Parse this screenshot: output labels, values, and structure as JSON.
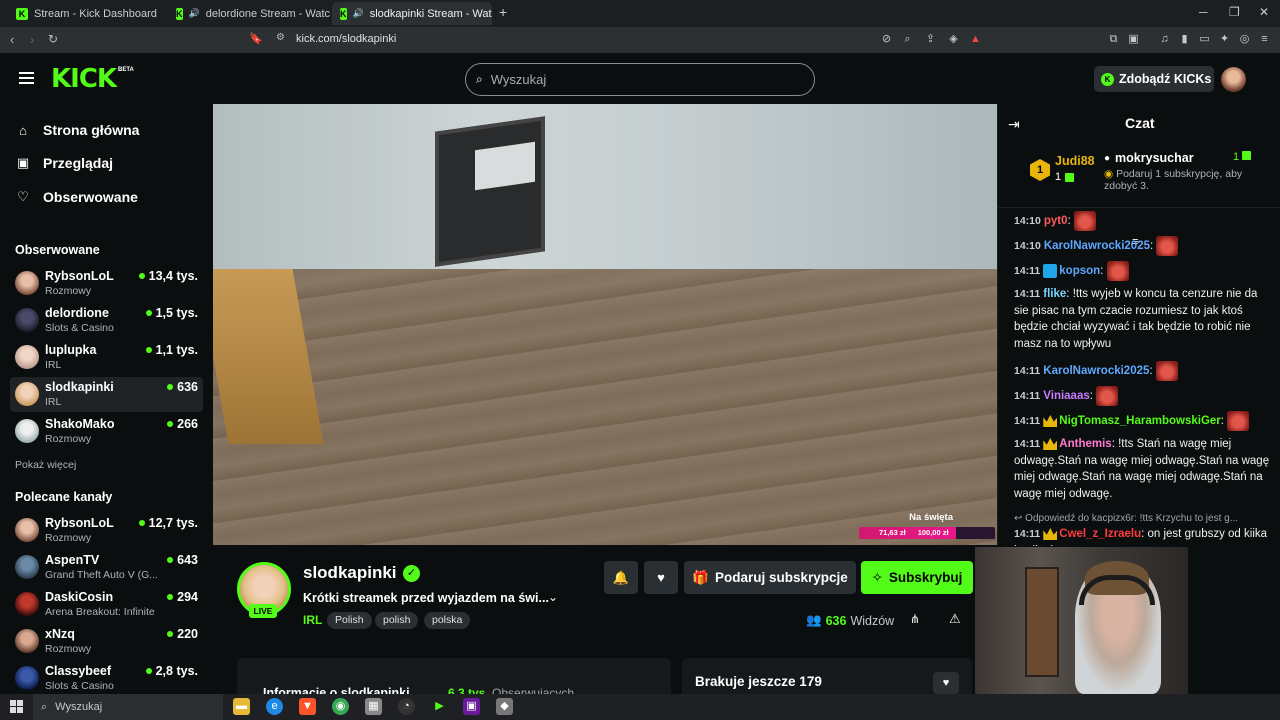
{
  "browser": {
    "tabs": [
      {
        "title": "Stream - Kick Dashboard"
      },
      {
        "title": "delordione Stream - Watch Live o"
      },
      {
        "title": "slodkapinki Stream - Watch Li"
      }
    ],
    "url": "kick.com/slodkapinki"
  },
  "header": {
    "logo": "KICK",
    "logo_tag": "BETA",
    "search_placeholder": "Wyszukaj",
    "get_kicks": "Zdobądź KICKs"
  },
  "sidebar": {
    "nav": [
      {
        "label": "Strona główna",
        "icon": "home-icon"
      },
      {
        "label": "Przeglądaj",
        "icon": "browse-icon"
      },
      {
        "label": "Obserwowane",
        "icon": "heart-icon"
      }
    ],
    "following_title": "Obserwowane",
    "following": [
      {
        "name": "RybsonLoL",
        "category": "Rozmowy",
        "viewers": "13,4 tys."
      },
      {
        "name": "delordione",
        "category": "Slots & Casino",
        "viewers": "1,5 tys."
      },
      {
        "name": "luplupka",
        "category": "IRL",
        "viewers": "1,1 tys."
      },
      {
        "name": "slodkapinki",
        "category": "IRL",
        "viewers": "636"
      },
      {
        "name": "ShakoMako",
        "category": "Rozmowy",
        "viewers": "266"
      }
    ],
    "show_more": "Pokaż więcej",
    "recommended_title": "Polecane kanały",
    "recommended": [
      {
        "name": "RybsonLoL",
        "category": "Rozmowy",
        "viewers": "12,7 tys."
      },
      {
        "name": "AspenTV",
        "category": "Grand Theft Auto V (G...",
        "viewers": "643"
      },
      {
        "name": "DaskiCosin",
        "category": "Arena Breakout: Infinite",
        "viewers": "294"
      },
      {
        "name": "xNzq",
        "category": "Rozmowy",
        "viewers": "220"
      },
      {
        "name": "Classybeef",
        "category": "Slots & Casino",
        "viewers": "2,8 tys."
      }
    ]
  },
  "video": {
    "goal_title": "Na święta",
    "goal_current": "71,63 zł",
    "goal_target": "100,00 zł",
    "goal_progress": 0.7163
  },
  "channel": {
    "name": "slodkapinki",
    "live": "LIVE",
    "title": "Krótki streamek przed wyjazdem na świ...",
    "category": "IRL",
    "tags": [
      "Polish",
      "polish",
      "polska"
    ],
    "gift_sub": "Podaruj subskrypcje",
    "subscribe": "Subskrybuj",
    "viewers": "636",
    "viewers_label": "Widzów",
    "about_title": "Informacje o slodkapinki",
    "followers": "6,3 tys.",
    "followers_label": "Obserwujących",
    "goal_card_title": "Brakuje jeszcze 179"
  },
  "chat": {
    "title": "Czat",
    "top_gifter": {
      "rank": "1",
      "name": "Judi88",
      "count": "1"
    },
    "pinned": {
      "name": "mokrysuchar",
      "count": "1",
      "text": "Podaruj 1 subskrypcję, aby zdobyć 3."
    },
    "messages": [
      {
        "time": "14:10",
        "user": "pyt0",
        "color": "#ff5a5a",
        "text": ""
      },
      {
        "time": "14:10",
        "user": "KarolNawrocki2025",
        "color": "#5fa8ff",
        "text": ""
      },
      {
        "time": "14:11",
        "user": "kopson",
        "color": "#5fa8ff",
        "text": ""
      },
      {
        "time": "14:11",
        "user": "flike",
        "color": "#7ad6ff",
        "text": "!tts wyjeb w koncu ta cenzure nie da sie pisac na tym czacie rozumiesz to jak ktoś będzie chciał wyzywać i tak będzie to robić nie masz na to wpływu"
      },
      {
        "time": "14:11",
        "user": "KarolNawrocki2025",
        "color": "#5fa8ff",
        "text": ""
      },
      {
        "time": "14:11",
        "user": "Viniaaas",
        "color": "#c77dff",
        "text": ""
      },
      {
        "time": "14:11",
        "user": "NigTomasz_HarambowskiGer",
        "color": "#53fc18",
        "text": ""
      },
      {
        "time": "14:11",
        "user": "Anthemis",
        "color": "#ff7ad6",
        "text": "!tts Stań na wagę miej odwagę.Stań na wagę miej odwagę.Stań na wagę miej odwagę.Stań na wagę miej odwagę.Stań na wagę miej odwagę."
      },
      {
        "time": "14:11",
        "user": "Cwel_z_Izraelu",
        "color": "#ff3b3b",
        "text": "on jest grubszy od kiika i nail xd"
      }
    ],
    "reply_preview": "Odpowiedź do kacpizx6r: !tts Krzychu to jest g..."
  },
  "taskbar": {
    "search": "Wyszukaj"
  }
}
